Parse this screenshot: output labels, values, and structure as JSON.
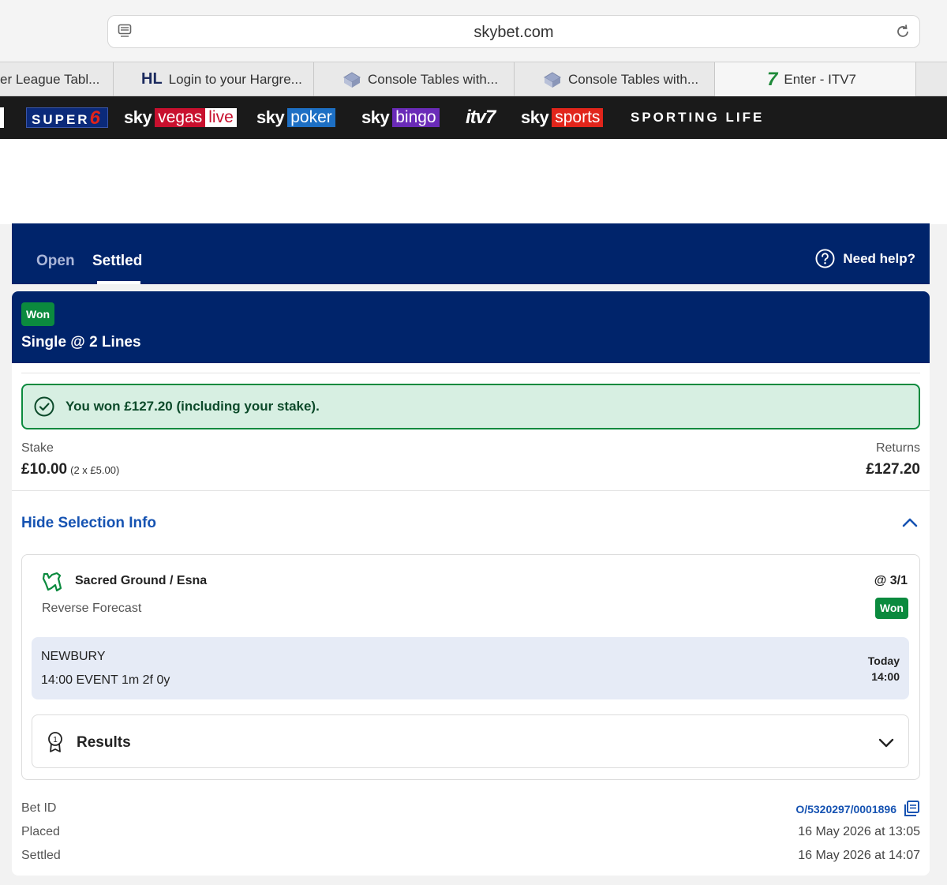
{
  "browser": {
    "url": "skybet.com",
    "tabs": [
      {
        "label": "er League Tabl...",
        "icon": "none"
      },
      {
        "label": "Login to your Hargre...",
        "icon": "hl-logo"
      },
      {
        "label": "Console Tables with...",
        "icon": "table-favicon"
      },
      {
        "label": "Console Tables with...",
        "icon": "table-favicon"
      },
      {
        "label": "Enter - ITV7",
        "icon": "itv7-logo"
      }
    ],
    "tab_hl_text": "HL",
    "tab_itv7_text": "7"
  },
  "brand_nav": {
    "super6": "SUPER",
    "super6_num": "6",
    "sky": "sky",
    "vegas": "vegas",
    "vegas_live": "live",
    "poker": "poker",
    "bingo": "bingo",
    "itv7": "itv7",
    "sports": "sports",
    "sporting_life": "SPORTING LIFE"
  },
  "bets_nav": {
    "open_label": "Open",
    "settled_label": "Settled",
    "help_label": "Need help?"
  },
  "bet": {
    "status": "Won",
    "type": "Single @ 2 Lines",
    "win_message": "You won £127.20 (including your stake).",
    "stake_label": "Stake",
    "stake_value": "£10.00",
    "stake_detail": "(2 x £5.00)",
    "returns_label": "Returns",
    "returns_value": "£127.20",
    "toggle_label": "Hide Selection Info",
    "selection": {
      "name": "Sacred Ground / Esna",
      "odds": "@ 3/1",
      "market": "Reverse Forecast",
      "status": "Won",
      "venue": "NEWBURY",
      "event": "14:00 EVENT 1m 2f 0y",
      "day": "Today",
      "time": "14:00"
    },
    "results_label": "Results",
    "bet_id_label": "Bet ID",
    "bet_id": "O/5320297/0001896",
    "placed_label": "Placed",
    "placed_value": "16 May 2026 at 13:05",
    "settled_label": "Settled",
    "settled_value": "16 May 2026 at 14:07"
  },
  "colors": {
    "sky_blue": "#00246b",
    "won_green": "#0b8a3e",
    "link_blue": "#1653b2"
  }
}
